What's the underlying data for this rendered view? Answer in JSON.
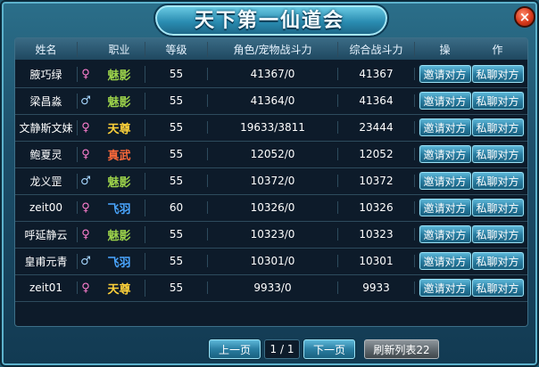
{
  "window": {
    "title": "天下第一仙道会",
    "close_label": "×"
  },
  "table": {
    "headers": [
      "姓名",
      "职业",
      "等级",
      "角色/宠物战斗力",
      "综合战斗力",
      "操",
      "作"
    ],
    "rows": [
      {
        "name": "腋巧绿",
        "sex": "female",
        "sex_icon": "♀",
        "job": "魅影",
        "job_color": "#9bd14a",
        "level": "55",
        "power": "41367/0",
        "total": "41367",
        "invite": "邀请对方",
        "chat": "私聊对方"
      },
      {
        "name": "梁昌淼",
        "sex": "male",
        "sex_icon": "♂",
        "job": "魅影",
        "job_color": "#9bd14a",
        "level": "55",
        "power": "41364/0",
        "total": "41364",
        "invite": "邀请对方",
        "chat": "私聊对方"
      },
      {
        "name": "文静斯文妹",
        "sex": "female",
        "sex_icon": "♀",
        "job": "天尊",
        "job_color": "#ffd23a",
        "level": "55",
        "power": "19633/3811",
        "total": "23444",
        "invite": "邀请对方",
        "chat": "私聊对方"
      },
      {
        "name": "鲍夏灵",
        "sex": "female",
        "sex_icon": "♀",
        "job": "真武",
        "job_color": "#ff6a3a",
        "level": "55",
        "power": "12052/0",
        "total": "12052",
        "invite": "邀请对方",
        "chat": "私聊对方"
      },
      {
        "name": "龙义罡",
        "sex": "male",
        "sex_icon": "♂",
        "job": "魅影",
        "job_color": "#9bd14a",
        "level": "55",
        "power": "10372/0",
        "total": "10372",
        "invite": "邀请对方",
        "chat": "私聊对方"
      },
      {
        "name": "zeit00",
        "sex": "female",
        "sex_icon": "♀",
        "job": "飞羽",
        "job_color": "#4aa6ff",
        "level": "60",
        "power": "10326/0",
        "total": "10326",
        "invite": "邀请对方",
        "chat": "私聊对方"
      },
      {
        "name": "呼延静云",
        "sex": "female",
        "sex_icon": "♀",
        "job": "魅影",
        "job_color": "#9bd14a",
        "level": "55",
        "power": "10323/0",
        "total": "10323",
        "invite": "邀请对方",
        "chat": "私聊对方"
      },
      {
        "name": "皇甫元青",
        "sex": "male",
        "sex_icon": "♂",
        "job": "飞羽",
        "job_color": "#4aa6ff",
        "level": "55",
        "power": "10301/0",
        "total": "10301",
        "invite": "邀请对方",
        "chat": "私聊对方"
      },
      {
        "name": "zeit01",
        "sex": "female",
        "sex_icon": "♀",
        "job": "天尊",
        "job_color": "#ffd23a",
        "level": "55",
        "power": "9933/0",
        "total": "9933",
        "invite": "邀请对方",
        "chat": "私聊对方"
      }
    ]
  },
  "pagination": {
    "prev_label": "上一页",
    "page_info": "1 / 1",
    "next_label": "下一页",
    "refresh_label": "刷新列表22"
  },
  "colors": {
    "female": "#ff7fd0",
    "male": "#a8d8ff",
    "button": "#2a7ea2",
    "refresh": "#5b646a",
    "panel": "#0d1b2a"
  }
}
